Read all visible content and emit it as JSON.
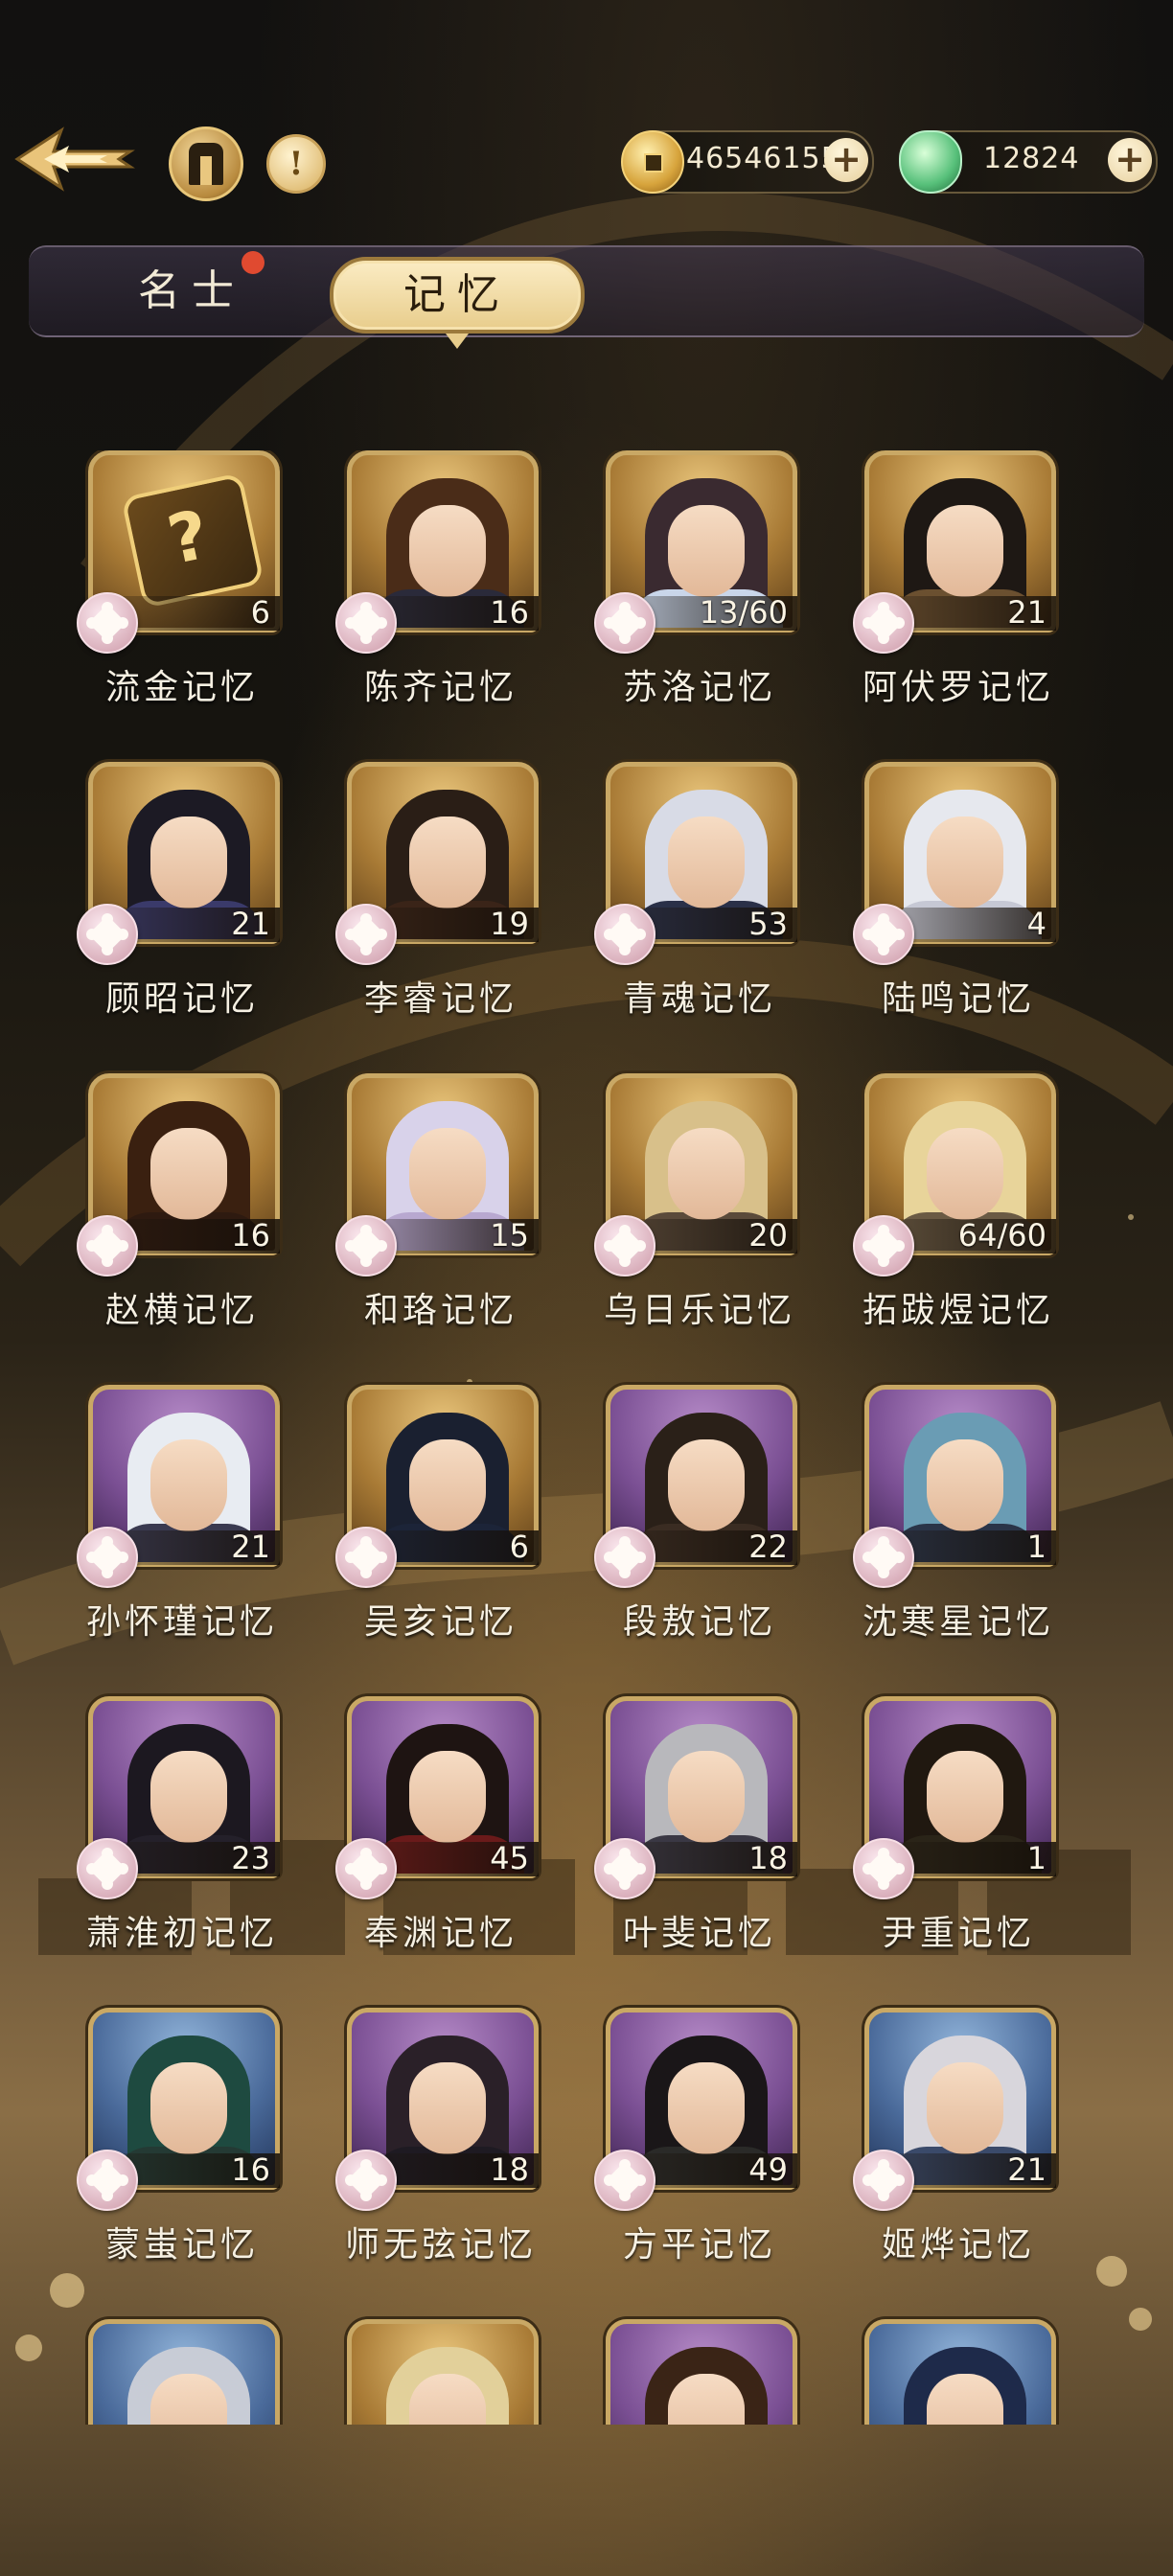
{
  "topbar": {
    "gold_amount": "46546155",
    "jade_amount": "12824",
    "info_glyph": "!"
  },
  "tabs": {
    "mingshi": "名士",
    "jiyi": "记忆"
  },
  "cards": [
    {
      "name": "流金记忆",
      "count": "6",
      "frame": "gold",
      "hair": "#3b2812",
      "skin": true,
      "cloth": "#7a1f1f",
      "mystery": true
    },
    {
      "name": "陈齐记忆",
      "count": "16",
      "frame": "gold",
      "hair": "#4a2c18",
      "cloth": "#2a2a3a"
    },
    {
      "name": "苏洛记忆",
      "count": "13/60",
      "frame": "gold",
      "hair": "#3a2a30",
      "cloth": "#c9d6ea"
    },
    {
      "name": "阿伏罗记忆",
      "count": "21",
      "frame": "gold",
      "hair": "#1e1814",
      "cloth": "#6b5030"
    },
    {
      "name": "顾昭记忆",
      "count": "21",
      "frame": "gold",
      "hair": "#1c1a24",
      "cloth": "#3a3a6a"
    },
    {
      "name": "李睿记忆",
      "count": "19",
      "frame": "gold",
      "hair": "#2a1e16",
      "cloth": "#3a2418"
    },
    {
      "name": "青魂记忆",
      "count": "53",
      "frame": "gold",
      "hair": "#d8dbe6",
      "cloth": "#2a3048"
    },
    {
      "name": "陆鸣记忆",
      "count": "4",
      "frame": "gold",
      "hair": "#e6e8ee",
      "cloth": "#c6c8d4"
    },
    {
      "name": "赵横记忆",
      "count": "16",
      "frame": "gold",
      "hair": "#3a2010",
      "cloth": "#2e1a10"
    },
    {
      "name": "和珞记忆",
      "count": "15",
      "frame": "gold",
      "hair": "#d8d2ea",
      "cloth": "#b8a8d0"
    },
    {
      "name": "乌日乐记忆",
      "count": "20",
      "frame": "gold",
      "hair": "#d8c08a",
      "cloth": "#5a4a3a"
    },
    {
      "name": "拓跋煜记忆",
      "count": "64/60",
      "frame": "gold",
      "hair": "#e8d49a",
      "cloth": "#6a5a44"
    },
    {
      "name": "孙怀瑾记忆",
      "count": "21",
      "frame": "purple",
      "hair": "#e8ecf2",
      "cloth": "#3a3a50"
    },
    {
      "name": "吴亥记忆",
      "count": "6",
      "frame": "gold",
      "hair": "#1a2030",
      "cloth": "#1c2438"
    },
    {
      "name": "段敖记忆",
      "count": "22",
      "frame": "purple",
      "hair": "#2a2018",
      "cloth": "#3a2c22"
    },
    {
      "name": "沈寒星记忆",
      "count": "1",
      "frame": "purple",
      "hair": "#6a9cb4",
      "cloth": "#2a3448"
    },
    {
      "name": "萧淮初记忆",
      "count": "23",
      "frame": "purple",
      "hair": "#1c1820",
      "cloth": "#24202a"
    },
    {
      "name": "奉渊记忆",
      "count": "45",
      "frame": "purple",
      "hair": "#1e1412",
      "cloth": "#6a1a1a"
    },
    {
      "name": "叶斐记忆",
      "count": "18",
      "frame": "purple",
      "hair": "#b8b8bc",
      "cloth": "#3a3844"
    },
    {
      "name": "尹重记忆",
      "count": "1",
      "frame": "purple",
      "hair": "#201810",
      "cloth": "#2a2418"
    },
    {
      "name": "蒙蚩记忆",
      "count": "16",
      "frame": "blue",
      "hair": "#1e4a40",
      "cloth": "#243a34"
    },
    {
      "name": "师无弦记忆",
      "count": "18",
      "frame": "purple",
      "hair": "#2a2028",
      "cloth": "#1e1a22"
    },
    {
      "name": "方平记忆",
      "count": "49",
      "frame": "purple",
      "hair": "#1a1618",
      "cloth": "#2a2a28"
    },
    {
      "name": "姬烨记忆",
      "count": "21",
      "frame": "blue",
      "hair": "#d8d6dc",
      "cloth": "#3a4a6a"
    },
    {
      "name": "",
      "count": "",
      "frame": "blue",
      "hair": "#c8ccd6",
      "cloth": "#3a4a6a"
    },
    {
      "name": "",
      "count": "",
      "frame": "gold",
      "hair": "#e2d09a",
      "cloth": "#5a4a30"
    },
    {
      "name": "",
      "count": "",
      "frame": "purple",
      "hair": "#3a2416",
      "cloth": "#2a2018"
    },
    {
      "name": "",
      "count": "",
      "frame": "blue",
      "hair": "#1e2a4a",
      "cloth": "#22304a"
    }
  ],
  "colors": {
    "accent_gold": "#c9a865",
    "tab_active_bg": "#f3dfae",
    "notification_dot": "#e04a30"
  },
  "icons": {
    "back": "back-arrow-icon",
    "codex": "codex-pillar-icon",
    "info": "info-icon",
    "gold": "gold-coin-icon",
    "jade": "jade-gem-icon",
    "plus": "plus-icon",
    "puzzle": "puzzle-piece-icon"
  }
}
